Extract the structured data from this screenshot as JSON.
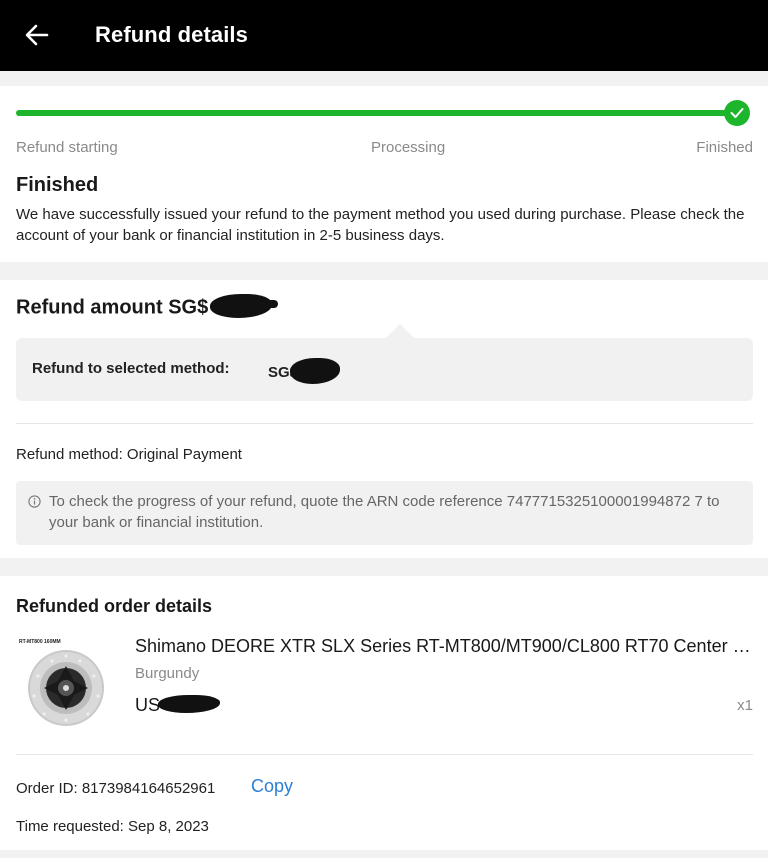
{
  "header": {
    "title": "Refund details"
  },
  "progress": {
    "steps": [
      "Refund starting",
      "Processing",
      "Finished"
    ],
    "completed_fraction": 1.0,
    "accent_color": "#1db52b"
  },
  "status": {
    "title": "Finished",
    "description": "We have successfully issued your refund to the payment method you used during purchase. Please check the account of your bank or financial institution in 2-5 business days."
  },
  "refund": {
    "amount_label": "Refund amount SG$",
    "selected_method_label": "Refund to selected method:",
    "selected_method_currency": "SG$",
    "method_text": "Refund method: Original Payment",
    "info_text": "To check the progress of your refund, quote the ARN code reference 7477715325100001994872 7 to your bank or financial institution."
  },
  "order": {
    "section_title": "Refunded order details",
    "thumb_caption": "RT-MT800 160MM",
    "product_title": "Shimano DEORE XTR SLX Series RT-MT800/MT900/CL800 RT70 Center Lock Disc Brake Rotor",
    "variant": "Burgundy",
    "price_currency": "US",
    "quantity": "x1",
    "order_id_text": "Order ID: 8173984164652961",
    "copy_label": "Copy",
    "time_requested": "Time requested: Sep 8, 2023",
    "link_color": "#2c7fd6"
  },
  "icons": {
    "back": "arrow-left-icon",
    "check": "check-icon",
    "info": "info-circle-icon"
  }
}
